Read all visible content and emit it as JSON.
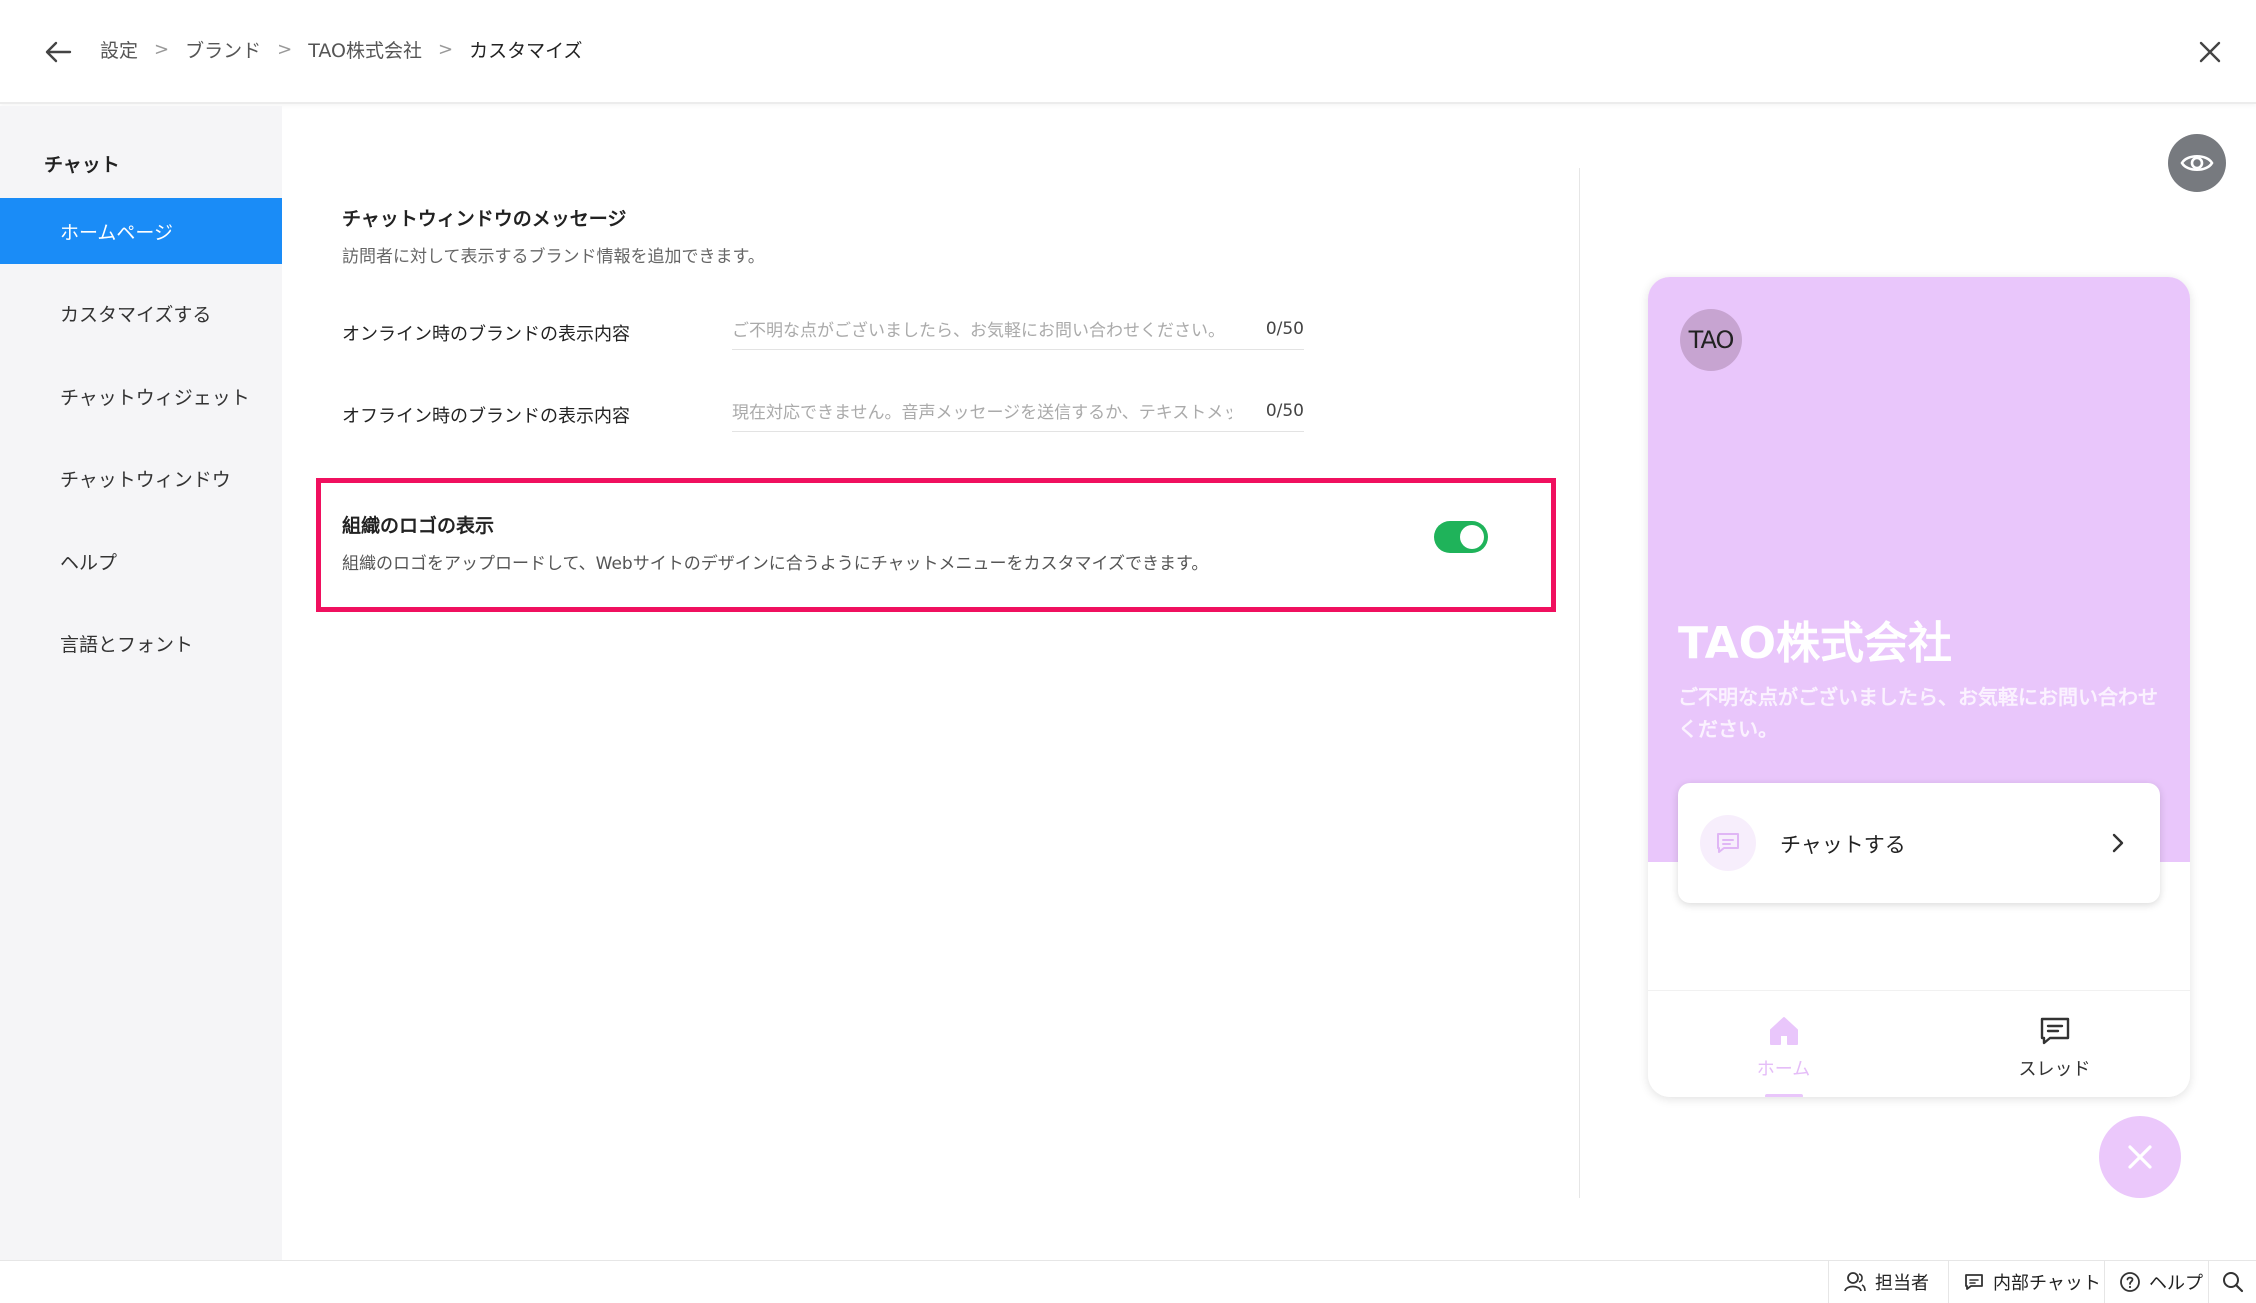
{
  "breadcrumb": [
    "設定",
    "ブランド",
    "TAO株式会社",
    "カスタマイズ"
  ],
  "sidebar": {
    "heading": "チャット",
    "items": [
      {
        "label": "ホームページ"
      },
      {
        "label": "カスタマイズする"
      },
      {
        "label": "チャットウィジェット"
      },
      {
        "label": "チャットウィンドウ"
      },
      {
        "label": "ヘルプ"
      },
      {
        "label": "言語とフォント"
      }
    ]
  },
  "main": {
    "section_title": "チャットウィンドウのメッセージ",
    "section_desc": "訪問者に対して表示するブランド情報を追加できます。",
    "online_label": "オンライン時のブランドの表示内容",
    "online_placeholder": "ご不明な点がございましたら、お気軽にお問い合わせください。",
    "online_count": "0/50",
    "offline_label": "オフライン時のブランドの表示内容",
    "offline_placeholder": "現在対応できません。音声メッセージを送信するか、テキストメッ",
    "offline_count": "0/50",
    "logo_title": "組織のロゴの表示",
    "logo_desc": "組織のロゴをアップロードして、Webサイトのデザインに合うようにチャットメニューをカスタマイズできます。",
    "logo_toggle_on": true
  },
  "preview": {
    "avatar_text": "TAO",
    "company": "TAO株式会社",
    "message": "ご不明な点がございましたら、お気軽にお問い合わせください。",
    "chat_button": "チャットする",
    "tabs": [
      {
        "label": "ホーム",
        "icon": "home-icon",
        "active": true
      },
      {
        "label": "スレッド",
        "icon": "thread-icon",
        "active": false
      }
    ]
  },
  "footer": {
    "agents": "担当者",
    "internal_chat": "内部チャット",
    "help": "ヘルプ"
  },
  "colors": {
    "accent": "#1a8cf7",
    "highlight": "#f0105f",
    "toggle_on": "#1fb35a",
    "preview_theme": "#e9c6fb"
  }
}
